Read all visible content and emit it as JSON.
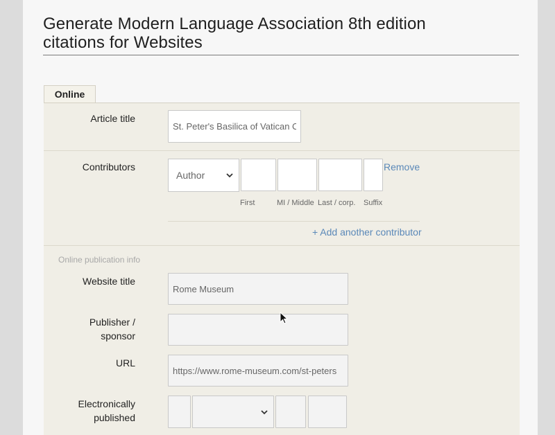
{
  "header": {
    "title_line1": "Generate Modern Language Association 8th edition",
    "title_line2": "citations for Websites"
  },
  "tabs": [
    {
      "label": "Online"
    }
  ],
  "form": {
    "article_title": {
      "label": "Article title",
      "value": "St. Peter's Basilica of Vatican C"
    },
    "contributors": {
      "label": "Contributors",
      "role_select": "Author",
      "remove_label": "Remove",
      "sublabels": {
        "first": "First",
        "mi": "MI / Middle",
        "last": "Last / corp.",
        "suffix": "Suffix"
      },
      "add_label": "+ Add another contributor"
    },
    "publication": {
      "caption": "Online publication info",
      "website_title": {
        "label": "Website title",
        "value": "Rome Museum"
      },
      "publisher": {
        "label_line1": "Publisher /",
        "label_line2": "sponsor",
        "value": ""
      },
      "url": {
        "label": "URL",
        "value": "https://www.rome-museum.com/st-peters"
      },
      "electronically_published": {
        "label_line1": "Electronically",
        "label_line2": "published"
      }
    }
  },
  "icons": {
    "dropdown": "chevron-down-icon",
    "cursor": "mouse-pointer-icon"
  },
  "colors": {
    "link": "#5a88b8",
    "form_background": "#f0eee6"
  }
}
